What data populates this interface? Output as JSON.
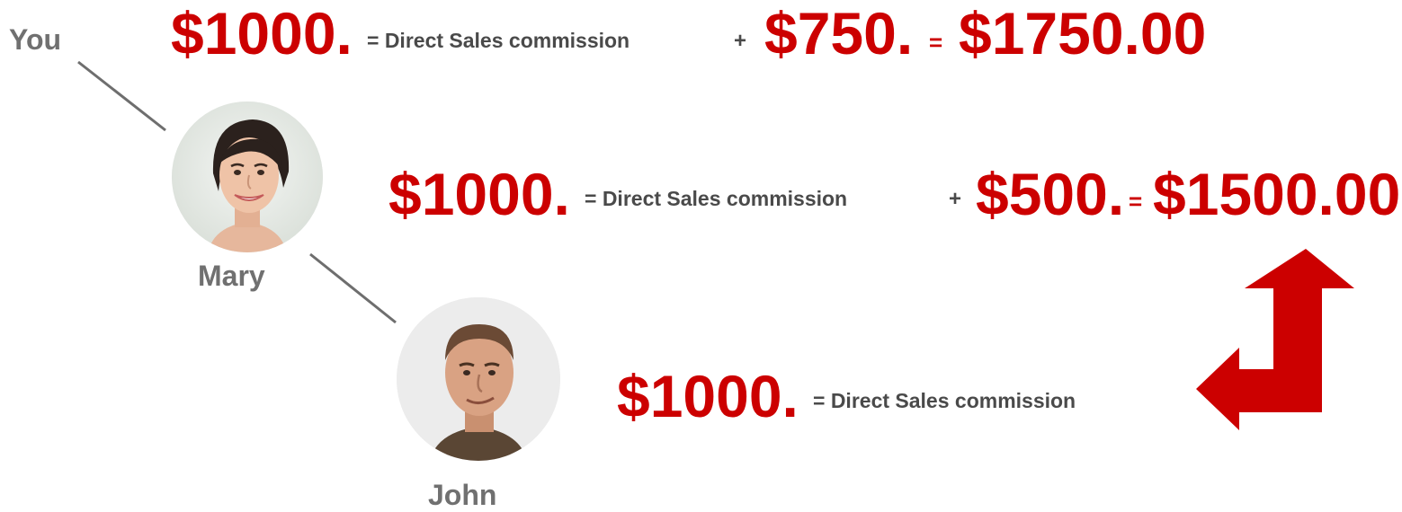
{
  "people": {
    "you": "You",
    "mary": "Mary",
    "john": "John"
  },
  "rows": {
    "you": {
      "amount": "$1000.",
      "label": "= Direct Sales commission",
      "plus": "+",
      "override": "$750.",
      "equals": "=",
      "total": "$1750.00"
    },
    "mary": {
      "amount": "$1000.",
      "label": "= Direct Sales commission",
      "plus": "+",
      "override": "$500.",
      "equals": "=",
      "total": "$1500.00"
    },
    "john": {
      "amount": "$1000.",
      "label": "= Direct Sales commission"
    }
  },
  "colors": {
    "accent": "#cc0000",
    "label": "#4a4a4a",
    "name": "#707070",
    "connector": "#6e6e6e"
  },
  "icons": {
    "arrow": "turn-up-arrow-icon"
  }
}
